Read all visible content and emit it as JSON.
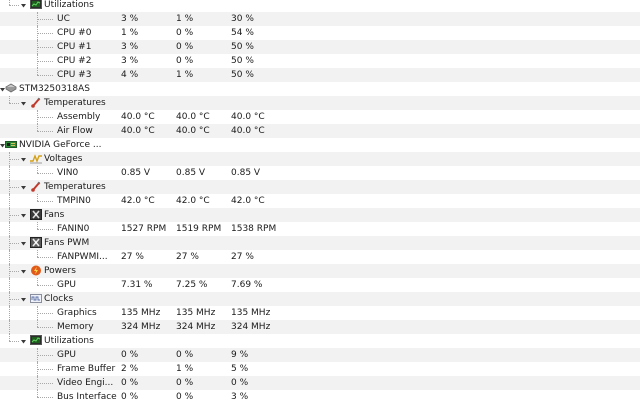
{
  "tree": [
    {
      "type": "group",
      "id": "g-util-cpu",
      "icon": "utilization-icon",
      "name": "Utilizations",
      "top": true
    },
    {
      "type": "sensor",
      "name": "UC",
      "v": [
        "3 %",
        "1 %",
        "30 %"
      ]
    },
    {
      "type": "sensor",
      "name": "CPU #0",
      "v": [
        "1 %",
        "0 %",
        "54 %"
      ]
    },
    {
      "type": "sensor",
      "name": "CPU #1",
      "v": [
        "3 %",
        "0 %",
        "50 %"
      ]
    },
    {
      "type": "sensor",
      "name": "CPU #2",
      "v": [
        "3 %",
        "0 %",
        "50 %"
      ]
    },
    {
      "type": "sensor",
      "name": "CPU #3",
      "v": [
        "4 %",
        "1 %",
        "50 %"
      ],
      "lastInGroup": true
    },
    {
      "type": "device",
      "icon": "hard-drive-icon",
      "name": "STM3250318AS"
    },
    {
      "type": "group",
      "icon": "thermometer-icon",
      "name": "Temperatures"
    },
    {
      "type": "sensor",
      "name": "Assembly",
      "v": [
        "40.0 °C",
        "40.0 °C",
        "40.0 °C"
      ]
    },
    {
      "type": "sensor",
      "name": "Air Flow",
      "v": [
        "40.0 °C",
        "40.0 °C",
        "40.0 °C"
      ],
      "lastInGroup": true
    },
    {
      "type": "device",
      "icon": "graphics-card-icon",
      "name": "NVIDIA GeForce ..."
    },
    {
      "type": "group",
      "icon": "voltage-icon",
      "name": "Voltages"
    },
    {
      "type": "sensor",
      "name": "VIN0",
      "v": [
        "0.85 V",
        "0.85 V",
        "0.85 V"
      ],
      "lastInGroup": true
    },
    {
      "type": "group",
      "icon": "thermometer-icon",
      "name": "Temperatures"
    },
    {
      "type": "sensor",
      "name": "TMPIN0",
      "v": [
        "42.0 °C",
        "42.0 °C",
        "42.0 °C"
      ],
      "lastInGroup": true
    },
    {
      "type": "group",
      "icon": "fan-icon",
      "name": "Fans"
    },
    {
      "type": "sensor",
      "name": "FANIN0",
      "v": [
        "1527 RPM",
        "1519 RPM",
        "1538 RPM"
      ],
      "lastInGroup": true
    },
    {
      "type": "group",
      "icon": "fan-pwm-icon",
      "name": "Fans PWM"
    },
    {
      "type": "sensor",
      "name": "FANPWMI...",
      "v": [
        "27 %",
        "27 %",
        "27 %"
      ],
      "lastInGroup": true
    },
    {
      "type": "group",
      "icon": "power-icon",
      "name": "Powers"
    },
    {
      "type": "sensor",
      "name": "GPU",
      "v": [
        "7.31 %",
        "7.25 %",
        "7.69 %"
      ],
      "lastInGroup": true
    },
    {
      "type": "group",
      "icon": "clock-icon",
      "name": "Clocks"
    },
    {
      "type": "sensor",
      "name": "Graphics",
      "v": [
        "135 MHz",
        "135 MHz",
        "135 MHz"
      ]
    },
    {
      "type": "sensor",
      "name": "Memory",
      "v": [
        "324 MHz",
        "324 MHz",
        "324 MHz"
      ],
      "lastInGroup": true
    },
    {
      "type": "group",
      "icon": "utilization-icon",
      "name": "Utilizations",
      "lastGroup": true
    },
    {
      "type": "sensor",
      "name": "GPU",
      "v": [
        "0 %",
        "0 %",
        "9 %"
      ]
    },
    {
      "type": "sensor",
      "name": "Frame Buffer",
      "v": [
        "2 %",
        "1 %",
        "5 %"
      ]
    },
    {
      "type": "sensor",
      "name": "Video Engi...",
      "v": [
        "0 %",
        "0 %",
        "0 %"
      ]
    },
    {
      "type": "sensor",
      "name": "Bus Interface",
      "v": [
        "0 %",
        "0 %",
        "3 %"
      ],
      "lastInGroup": true
    }
  ],
  "colors": {
    "row_alt": "#f2f2f2",
    "tree_line": "#a8a8a8",
    "text": "#1a1a1a"
  }
}
